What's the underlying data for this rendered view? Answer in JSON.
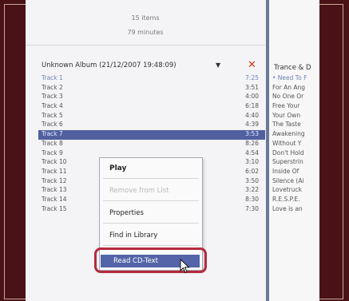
{
  "summary": {
    "items": "15 items",
    "minutes": "79 minutes"
  },
  "album": {
    "title": "Unknown Album (21/12/2007 19:48:09)",
    "dropdown": "▼"
  },
  "tracks": [
    {
      "name": "Track 1",
      "duration": "7:25"
    },
    {
      "name": "Track 2",
      "duration": "3:51"
    },
    {
      "name": "Track 3",
      "duration": "4:00"
    },
    {
      "name": "Track 4",
      "duration": "6:18"
    },
    {
      "name": "Track 5",
      "duration": "4:40"
    },
    {
      "name": "Track 6",
      "duration": "4:39"
    },
    {
      "name": "Track 7",
      "duration": "3:53"
    },
    {
      "name": "Track 8",
      "duration": "8:26"
    },
    {
      "name": "Track 9",
      "duration": "4:54"
    },
    {
      "name": "Track 10",
      "duration": "3:10"
    },
    {
      "name": "Track 11",
      "duration": "6:02"
    },
    {
      "name": "Track 12",
      "duration": "3:50"
    },
    {
      "name": "Track 13",
      "duration": "3:22"
    },
    {
      "name": "Track 14",
      "duration": "8:30"
    },
    {
      "name": "Track 15",
      "duration": "7:30"
    }
  ],
  "right_pane": {
    "album": "Trance & D",
    "items": [
      "• Need To F",
      "For An Ang",
      "No One Or",
      "Free Your",
      "Your Own",
      "The Taste",
      "Awakening",
      "Without Y",
      "Don't Hold",
      "Superstrin",
      "Inside Of",
      "Silence (Ai",
      "Lovetruck",
      "R.E.S.P.E.",
      "Love is an"
    ]
  },
  "context_menu": {
    "play": "Play",
    "remove": "Remove from List",
    "properties": "Properties",
    "find": "Find in Library",
    "read_cd_text": "Read CD-Text"
  },
  "colors": {
    "accent": "#5365a8",
    "callout": "#b42a3e",
    "background": "#4a1216",
    "remove": "#d03418"
  },
  "icons": {
    "remove": "x-icon",
    "cursor": "mouse-pointer-icon"
  }
}
